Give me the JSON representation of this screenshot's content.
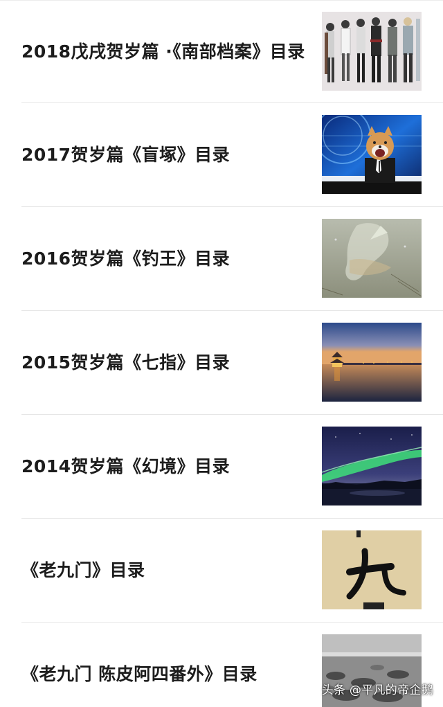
{
  "articles": [
    {
      "title": "2018戊戌贺岁篇 ·《南部档案》目录",
      "thumbnail": "anime-characters-illustration"
    },
    {
      "title": "2017贺岁篇《盲塚》目录",
      "thumbnail": "shiba-dog-news-anchor"
    },
    {
      "title": "2016贺岁篇《钓王》目录",
      "thumbnail": "fish-under-ice"
    },
    {
      "title": "2015贺岁篇《七指》目录",
      "thumbnail": "lake-pavilion-dusk"
    },
    {
      "title": "2014贺岁篇《幻境》目录",
      "thumbnail": "aurora-night-sky"
    },
    {
      "title": "《老九门》目录",
      "thumbnail": "calligraphy-nine"
    },
    {
      "title": "《老九门 陈皮阿四番外》目录",
      "thumbnail": "rocky-shore-grayscale"
    }
  ],
  "watermark": "头条 @平凡的帝企鹅"
}
